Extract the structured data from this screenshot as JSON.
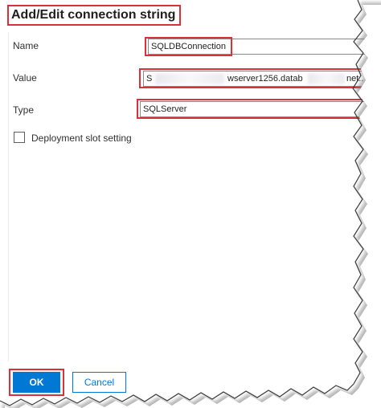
{
  "dialog": {
    "title": "Add/Edit connection string",
    "fields": {
      "name": {
        "label": "Name",
        "value": "SQLDBConnection"
      },
      "value": {
        "label": "Value",
        "value_prefix": "S",
        "value_middle": "wserver1256.datab",
        "value_suffix": "net.."
      },
      "type": {
        "label": "Type",
        "value": "SQLServer"
      }
    },
    "slot_setting": {
      "label": "Deployment slot setting",
      "checked": false
    },
    "buttons": {
      "ok": "OK",
      "cancel": "Cancel"
    }
  },
  "colors": {
    "annotation": "#d9303a",
    "primary": "#0078d4"
  }
}
